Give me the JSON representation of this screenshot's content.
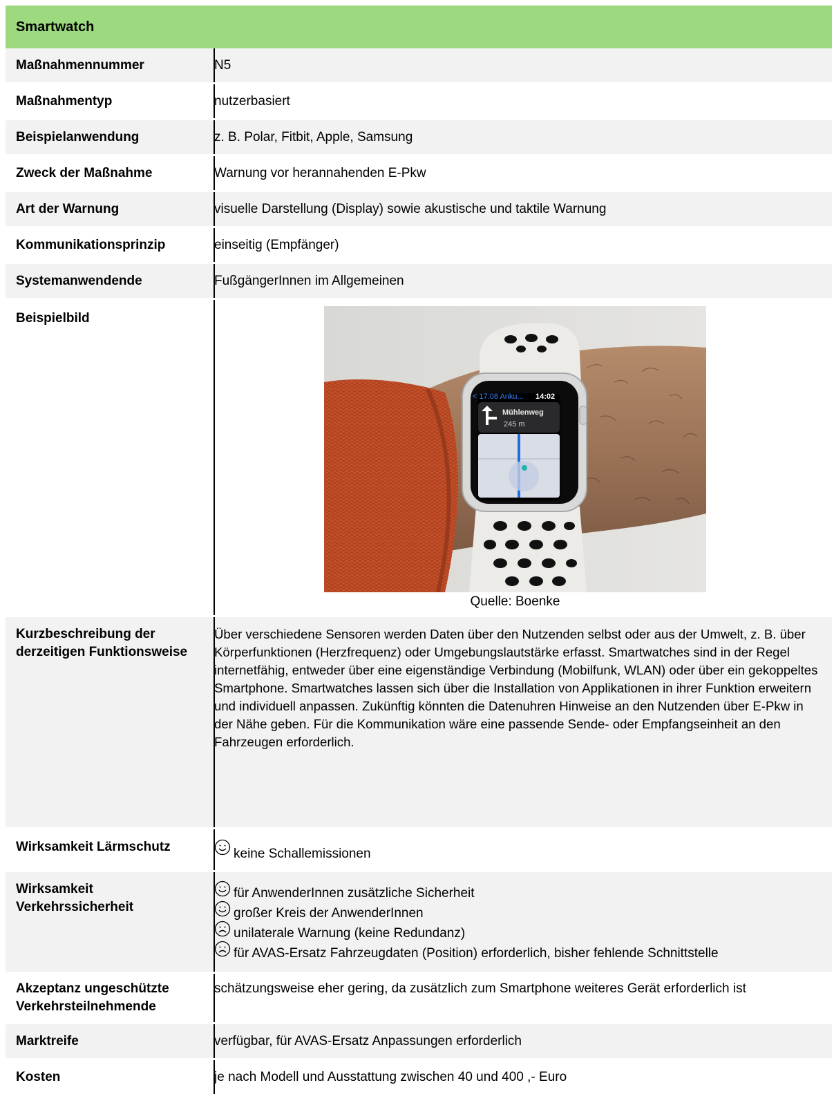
{
  "title": "Smartwatch",
  "rows": {
    "nummer": {
      "label": "Maßnahmennummer",
      "value": "N5"
    },
    "typ": {
      "label": "Maßnahmentyp",
      "value": "nutzerbasiert"
    },
    "beispiel": {
      "label": "Beispielanwendung",
      "value": "z. B. Polar, Fitbit, Apple, Samsung"
    },
    "zweck": {
      "label": "Zweck der Maßnahme",
      "value": "Warnung vor herannahenden E-Pkw"
    },
    "art": {
      "label": "Art der Warnung",
      "value": "visuelle Darstellung (Display) sowie akustische und taktile Warnung"
    },
    "komm": {
      "label": "Kommunikationsprinzip",
      "value": "einseitig (Empfänger)"
    },
    "system": {
      "label": "Systemanwendende",
      "value": "FußgängerInnen im Allgemeinen"
    },
    "bild": {
      "label": "Beispielbild",
      "caption": "Quelle: Boenke",
      "watch_screen": {
        "back": "< 17:08 Anku...",
        "time": "14:02",
        "street": "Mühlenweg",
        "distance": "245 m"
      }
    },
    "kurz": {
      "label": "Kurzbeschreibung der derzeitigen Funktionsweise",
      "value": "Über verschiedene Sensoren werden Daten über den Nutzenden selbst oder aus der Umwelt, z. B. über Körperfunktionen (Herzfrequenz) oder Umgebungslautstärke erfasst. Smartwatches sind in der Regel internetfähig, entweder über eine eigenständige Verbindung (Mobilfunk, WLAN) oder über ein gekoppeltes Smartphone. Smartwatches lassen sich über die Installation von Applikationen in ihrer Funktion erweitern und individuell anpassen. Zukünftig könnten die Datenuhren Hinweise an den Nutzenden über E-Pkw in der Nähe geben. Für die Kommunikation wäre eine passende Sende- oder Empfangseinheit an den Fahrzeugen erforderlich."
    },
    "laerm": {
      "label": "Wirksamkeit Lärmschutz",
      "value": "keine Schallemissionen",
      "icon": "smiley-happy-icon"
    },
    "sicher": {
      "label": "Wirksamkeit Verkehrssicherheit",
      "items": [
        {
          "text": "für AnwenderInnen zusätzliche Sicherheit",
          "icon": "smiley-happy-icon"
        },
        {
          "text": "großer Kreis der AnwenderInnen",
          "icon": "smiley-happy-icon"
        },
        {
          "text": "unilaterale Warnung (keine Redundanz)",
          "icon": "smiley-sad-icon"
        },
        {
          "text": "für AVAS-Ersatz Fahrzeugdaten (Position) erforderlich, bisher fehlende Schnittstelle",
          "icon": "smiley-sad-icon"
        }
      ]
    },
    "akzeptanz": {
      "label": "Akzeptanz ungeschützte Verkehrsteilnehmende",
      "value": "schätzungsweise eher gering, da zusätzlich zum Smartphone weiteres Gerät erforderlich ist"
    },
    "markt": {
      "label": "Marktreife",
      "value": "verfügbar, für AVAS-Ersatz Anpassungen erforderlich"
    },
    "kosten": {
      "label": "Kosten",
      "value": "je nach Modell und Ausstattung zwischen 40 und 400 ,- Euro"
    }
  },
  "colors": {
    "header": "#9dd97f",
    "shade": "#f2f2f2"
  }
}
